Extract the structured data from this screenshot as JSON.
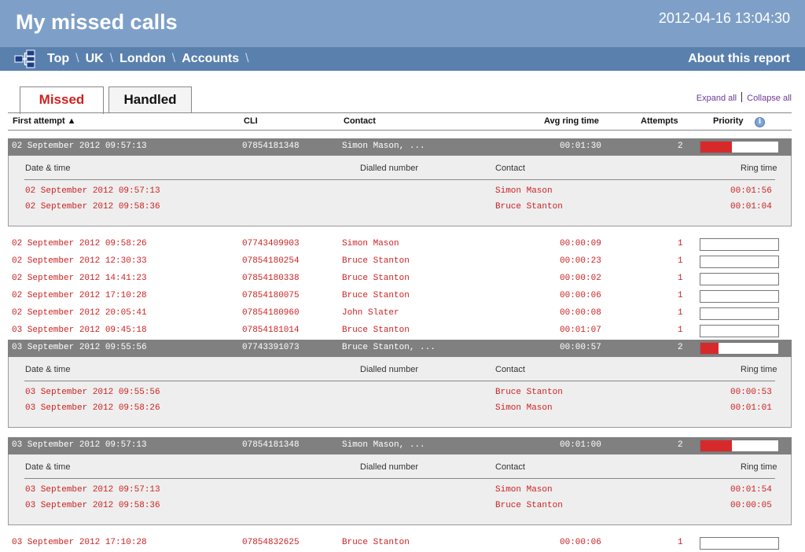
{
  "header": {
    "title": "My missed calls",
    "datetime": "2012-04-16 13:04:30"
  },
  "nav": {
    "icon": "hierarchy-icon",
    "crumbs": [
      "Top",
      "UK",
      "London",
      "Accounts"
    ],
    "sep": "\\",
    "about": "About this report"
  },
  "tabs": {
    "missed": "Missed",
    "handled": "Handled",
    "active": "Missed"
  },
  "links": {
    "expand_all": "Expand all",
    "collapse_all": "Collapse all"
  },
  "columns": {
    "first_attempt": "First attempt ▲",
    "cli": "CLI",
    "contact": "Contact",
    "avg_ring": "Avg ring time",
    "attempts": "Attempts",
    "priority": "Priority",
    "info_icon": "info-icon"
  },
  "detail_columns": {
    "datetime": "Date & time",
    "dialled": "Dialled number",
    "contact": "Contact",
    "ring": "Ring time"
  },
  "colors": {
    "header_bg": "#7ea0c8",
    "nav_bg": "#5a80ae",
    "group_bg": "#808080",
    "text_red": "#cc2222",
    "priority_fill": "#d8292a"
  },
  "groups": [
    {
      "first": "02 September 2012 09:57:13",
      "cli": "07854181348",
      "contact": "Simon Mason, ...",
      "avg": "00:01:30",
      "attempts": "2",
      "priority": 0.4,
      "calls": [
        {
          "datetime": "02 September 2012 09:57:13",
          "contact": "Simon Mason",
          "ring": "00:01:56"
        },
        {
          "datetime": "02 September 2012 09:58:36",
          "contact": "Bruce Stanton",
          "ring": "00:01:04"
        }
      ]
    },
    {
      "first": "03 September 2012 09:55:56",
      "cli": "07743391073",
      "contact": "Bruce Stanton, ...",
      "avg": "00:00:57",
      "attempts": "2",
      "priority": 0.23,
      "calls": [
        {
          "datetime": "03 September 2012 09:55:56",
          "contact": "Bruce Stanton",
          "ring": "00:00:53"
        },
        {
          "datetime": "03 September 2012 09:58:26",
          "contact": "Simon Mason",
          "ring": "00:01:01"
        }
      ]
    },
    {
      "first": "03 September 2012 09:57:13",
      "cli": "07854181348",
      "contact": "Simon Mason, ...",
      "avg": "00:01:00",
      "attempts": "2",
      "priority": 0.4,
      "calls": [
        {
          "datetime": "03 September 2012 09:57:13",
          "contact": "Simon Mason",
          "ring": "00:01:54"
        },
        {
          "datetime": "03 September 2012 09:58:36",
          "contact": "Bruce Stanton",
          "ring": "00:00:05"
        }
      ]
    }
  ],
  "rows": [
    {
      "first": "02 September 2012 09:58:26",
      "cli": "07743409903",
      "contact": "Simon Mason",
      "avg": "00:00:09",
      "attempts": "1",
      "priority": 0
    },
    {
      "first": "02 September 2012 12:30:33",
      "cli": "07854180254",
      "contact": "Bruce Stanton",
      "avg": "00:00:23",
      "attempts": "1",
      "priority": 0
    },
    {
      "first": "02 September 2012 14:41:23",
      "cli": "07854180338",
      "contact": "Bruce Stanton",
      "avg": "00:00:02",
      "attempts": "1",
      "priority": 0
    },
    {
      "first": "02 September 2012 17:10:28",
      "cli": "07854180075",
      "contact": "Bruce Stanton",
      "avg": "00:00:06",
      "attempts": "1",
      "priority": 0
    },
    {
      "first": "02 September 2012 20:05:41",
      "cli": "07854180960",
      "contact": "John Slater",
      "avg": "00:00:08",
      "attempts": "1",
      "priority": 0
    },
    {
      "first": "03 September 2012 09:45:18",
      "cli": "07854181014",
      "contact": "Bruce Stanton",
      "avg": "00:01:07",
      "attempts": "1",
      "priority": 0
    },
    {
      "first": "03 September 2012 17:10:28",
      "cli": "07854832625",
      "contact": "Bruce Stanton",
      "avg": "00:00:06",
      "attempts": "1",
      "priority": 0
    }
  ]
}
